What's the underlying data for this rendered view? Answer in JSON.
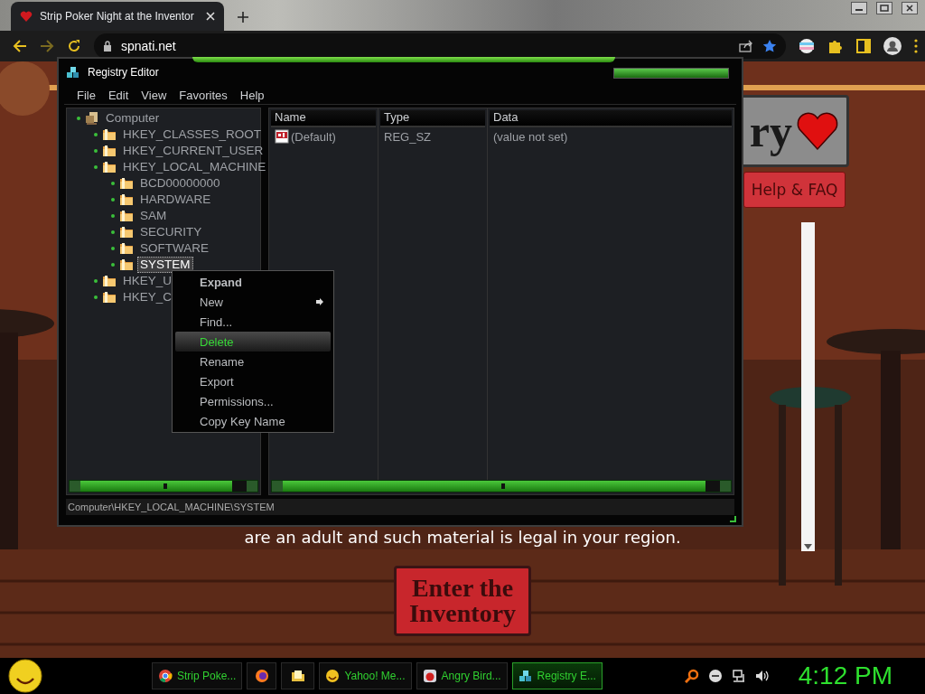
{
  "browser": {
    "tabs": [
      {
        "title": "Strip Poker Night at the Inventor",
        "selected": true
      }
    ],
    "url": "spnati.net"
  },
  "webpage": {
    "logo_text": "ry",
    "help_button": "Help & FAQ",
    "notice": "are an adult and such material is legal in your region.",
    "enter_button": "Enter the Inventory"
  },
  "registry_editor": {
    "title": "Registry Editor",
    "menu": [
      "File",
      "Edit",
      "View",
      "Favorites",
      "Help"
    ],
    "tree": [
      {
        "label": "Computer",
        "selected": false,
        "children": [
          {
            "label": "HKEY_CLASSES_ROOT",
            "selected": false
          },
          {
            "label": "HKEY_CURRENT_USER",
            "selected": false
          },
          {
            "label": "HKEY_LOCAL_MACHINE",
            "selected": false,
            "children": [
              {
                "label": "BCD00000000",
                "selected": false
              },
              {
                "label": "HARDWARE",
                "selected": false
              },
              {
                "label": "SAM",
                "selected": false
              },
              {
                "label": "SECURITY",
                "selected": false
              },
              {
                "label": "SOFTWARE",
                "selected": false
              },
              {
                "label": "SYSTEM",
                "selected": true
              }
            ]
          },
          {
            "label": "HKEY_U",
            "selected": false
          },
          {
            "label": "HKEY_C",
            "selected": false
          }
        ]
      }
    ],
    "columns": [
      "Name",
      "Type",
      "Data"
    ],
    "rows": [
      {
        "name": "(Default)",
        "type": "REG_SZ",
        "data": "(value not set)"
      }
    ],
    "status": "Computer\\HKEY_LOCAL_MACHINE\\SYSTEM"
  },
  "context_menu": [
    {
      "label": "Expand",
      "kind": "default",
      "selected": false
    },
    {
      "label": "New",
      "kind": "submenu",
      "selected": false
    },
    {
      "label": "Find...",
      "kind": "plain",
      "selected": false
    },
    {
      "label": "Delete",
      "kind": "plain",
      "selected": true
    },
    {
      "label": "Rename",
      "kind": "plain",
      "selected": false
    },
    {
      "label": "Export",
      "kind": "plain",
      "selected": false
    },
    {
      "label": "Permissions...",
      "kind": "plain",
      "selected": false
    },
    {
      "label": "Copy Key Name",
      "kind": "plain",
      "selected": false
    }
  ],
  "taskbar": {
    "items": [
      {
        "kind": "button",
        "label": "Strip Poke...",
        "selected": false
      },
      {
        "kind": "icon",
        "selected": false
      },
      {
        "kind": "icon",
        "selected": false
      },
      {
        "kind": "button",
        "label": "Yahoo! Me...",
        "selected": false
      },
      {
        "kind": "button",
        "label": "Angry Bird...",
        "selected": false
      },
      {
        "kind": "button",
        "label": "Registry E...",
        "selected": true
      }
    ],
    "clock": "4:12 PM"
  }
}
